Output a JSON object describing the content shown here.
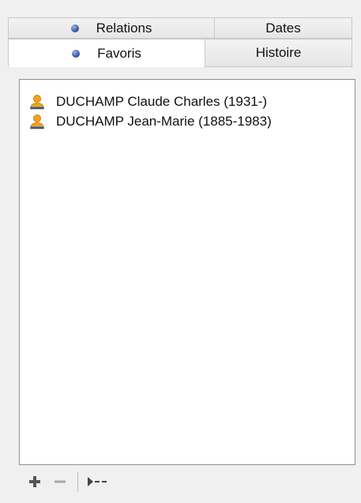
{
  "tabs": {
    "back_row": [
      {
        "label": "Relations",
        "has_dot": true,
        "selected": false
      },
      {
        "label": "Dates",
        "has_dot": false,
        "selected": false
      }
    ],
    "front_row": [
      {
        "label": "Favoris",
        "has_dot": true,
        "selected": true
      },
      {
        "label": "Histoire",
        "has_dot": false,
        "selected": false
      }
    ]
  },
  "favorites": {
    "items": [
      {
        "label": "DUCHAMP Claude Charles (1931-)",
        "icon": "person-icon"
      },
      {
        "label": "DUCHAMP Jean-Marie (1885-1983)",
        "icon": "person-icon"
      }
    ]
  },
  "toolbar": {
    "add_icon": "plus-icon",
    "remove_icon": "minus-icon",
    "goto_icon": "arrow-dashes-icon"
  },
  "colors": {
    "tab_dot": "#3d63a4",
    "person_icon_head": "#f2a21b",
    "person_icon_body": "#2c5aa0",
    "list_border": "#8f8f8f"
  }
}
